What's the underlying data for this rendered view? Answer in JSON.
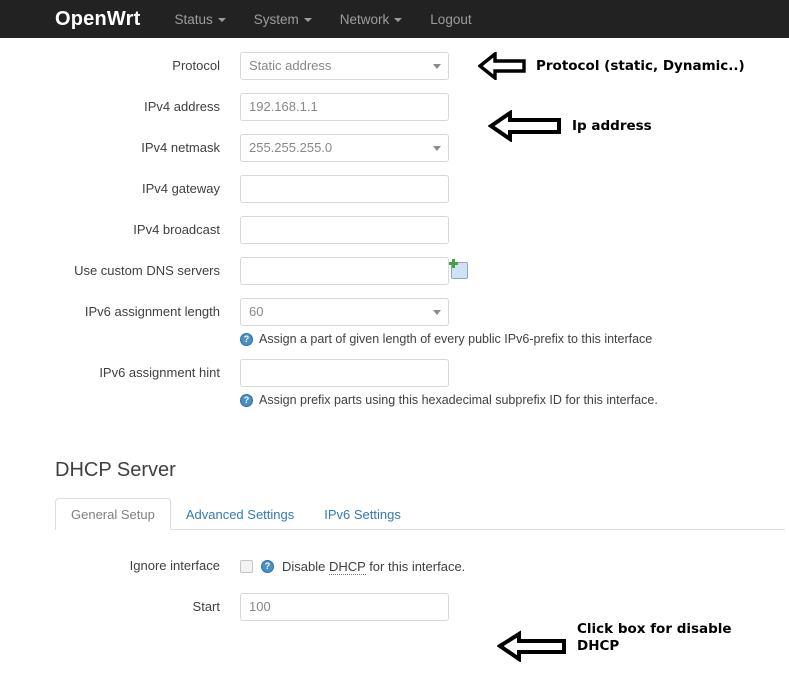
{
  "navbar": {
    "brand": "OpenWrt",
    "items": [
      {
        "label": "Status",
        "has_caret": true
      },
      {
        "label": "System",
        "has_caret": true
      },
      {
        "label": "Network",
        "has_caret": true
      },
      {
        "label": "Logout",
        "has_caret": false
      }
    ]
  },
  "form": {
    "protocol": {
      "label": "Protocol",
      "value": "Static address",
      "type": "select"
    },
    "ipv4_address": {
      "label": "IPv4 address",
      "value": "192.168.1.1",
      "type": "text"
    },
    "ipv4_netmask": {
      "label": "IPv4 netmask",
      "value": "255.255.255.0",
      "type": "select"
    },
    "ipv4_gateway": {
      "label": "IPv4 gateway",
      "value": "",
      "type": "text"
    },
    "ipv4_broadcast": {
      "label": "IPv4 broadcast",
      "value": "",
      "type": "text"
    },
    "custom_dns": {
      "label": "Use custom DNS servers",
      "value": "",
      "type": "text",
      "add_icon": "add-entry-icon"
    },
    "ipv6_assignment_length": {
      "label": "IPv6 assignment length",
      "value": "60",
      "type": "select",
      "help": "Assign a part of given length of every public IPv6-prefix to this interface",
      "help_icon": "help-icon"
    },
    "ipv6_assignment_hint": {
      "label": "IPv6 assignment hint",
      "value": "",
      "type": "text",
      "help": "Assign prefix parts using this hexadecimal subprefix ID for this interface.",
      "help_icon": "help-icon"
    }
  },
  "dhcp": {
    "title": "DHCP Server",
    "tabs": [
      {
        "label": "General Setup",
        "active": true
      },
      {
        "label": "Advanced Settings",
        "active": false
      },
      {
        "label": "IPv6 Settings",
        "active": false
      }
    ],
    "ignore_interface": {
      "label": "Ignore interface",
      "checked": false,
      "help_icon": "help-icon",
      "help_prefix": "Disable ",
      "help_abbr": "DHCP",
      "help_suffix": " for this interface."
    },
    "start": {
      "label": "Start",
      "value": "100",
      "type": "text"
    }
  },
  "annotations": [
    {
      "text": "Protocol (static, Dynamic..)",
      "icon": "left-arrow-icon"
    },
    {
      "text": "Ip address",
      "icon": "left-arrow-icon"
    },
    {
      "text": "Click box for disable\nDHCP",
      "icon": "left-arrow-icon"
    }
  ],
  "colors": {
    "navbar_bg": "#222222",
    "link_blue": "#337ab7",
    "help_icon_blue": "#4a90c4",
    "text": "#404040"
  }
}
